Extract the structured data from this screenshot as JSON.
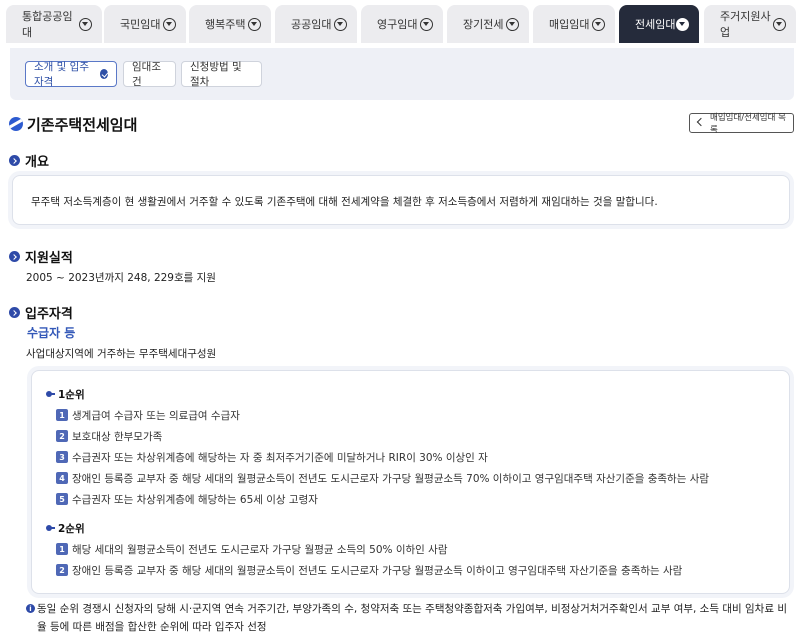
{
  "nav": {
    "tabs": [
      {
        "label": "통합공공임대"
      },
      {
        "label": "국민임대"
      },
      {
        "label": "행복주택"
      },
      {
        "label": "공공임대"
      },
      {
        "label": "영구임대"
      },
      {
        "label": "장기전세"
      },
      {
        "label": "매입임대"
      },
      {
        "label": "전세임대",
        "active": true
      },
      {
        "label": "주거지원사업"
      }
    ]
  },
  "subtabs": [
    {
      "label": "소개 및 입주자격",
      "active": true
    },
    {
      "label": "임대조건"
    },
    {
      "label": "신청방법 및 절차"
    }
  ],
  "page": {
    "title": "기존주택전세임대",
    "back_label": "매입임대/전세임대 목록"
  },
  "overview": {
    "heading": "개요",
    "text": "무주택 저소득계층이 현 생활권에서 거주할 수 있도록 기존주택에 대해 전세계약을 체결한 후 저소득층에서 저렴하게 재임대하는 것을 말합니다."
  },
  "performance": {
    "heading": "지원실적",
    "text": "2005 ~ 2023년까지 248, 229호를 지원"
  },
  "eligibility": {
    "heading": "입주자격",
    "subheading": "수급자 등",
    "description": "사업대상지역에 거주하는 무주택세대구성원",
    "rank1": {
      "title": "1순위",
      "items": [
        {
          "num": "1",
          "text": "생계급여 수급자 또는 의료급여 수급자"
        },
        {
          "num": "2",
          "text": "보호대상 한부모가족"
        },
        {
          "num": "3",
          "text": "수급권자 또는 차상위계층에 해당하는 자 중 최저주거기준에 미달하거나 RIR이 30% 이상인 자"
        },
        {
          "num": "4",
          "text": "장애인 등록증 교부자 중 해당 세대의 월평균소득이 전년도 도시근로자 가구당 월평균소득 70% 이하이고 영구임대주택 자산기준을 충족하는 사람"
        },
        {
          "num": "5",
          "text": "수급권자 또는 차상위계층에 해당하는 65세 이상 고령자"
        }
      ]
    },
    "rank2": {
      "title": "2순위",
      "items": [
        {
          "num": "1",
          "text": "해당 세대의 월평균소득이 전년도 도시근로자 가구당 월평균 소득의 50% 이하인 사람"
        },
        {
          "num": "2",
          "text": "장애인 등록증 교부자 중 해당 세대의 월평균소득이 전년도 도시근로자 가구당 월평균소득 이하이고 영구임대주택 자산기준을 충족하는 사람"
        }
      ]
    },
    "note": "동일 순위 경쟁시 신청자의 당해 시·군지역 연속 거주기간, 부양가족의 수, 청약저축 또는 주택청약종합저축 가입여부, 비정상거처거주확인서 교부 여부, 소득 대비 임차료 비율 등에 따른 배점을 합산한 순위에 따라 입주자 선정",
    "note_icon": "i"
  }
}
